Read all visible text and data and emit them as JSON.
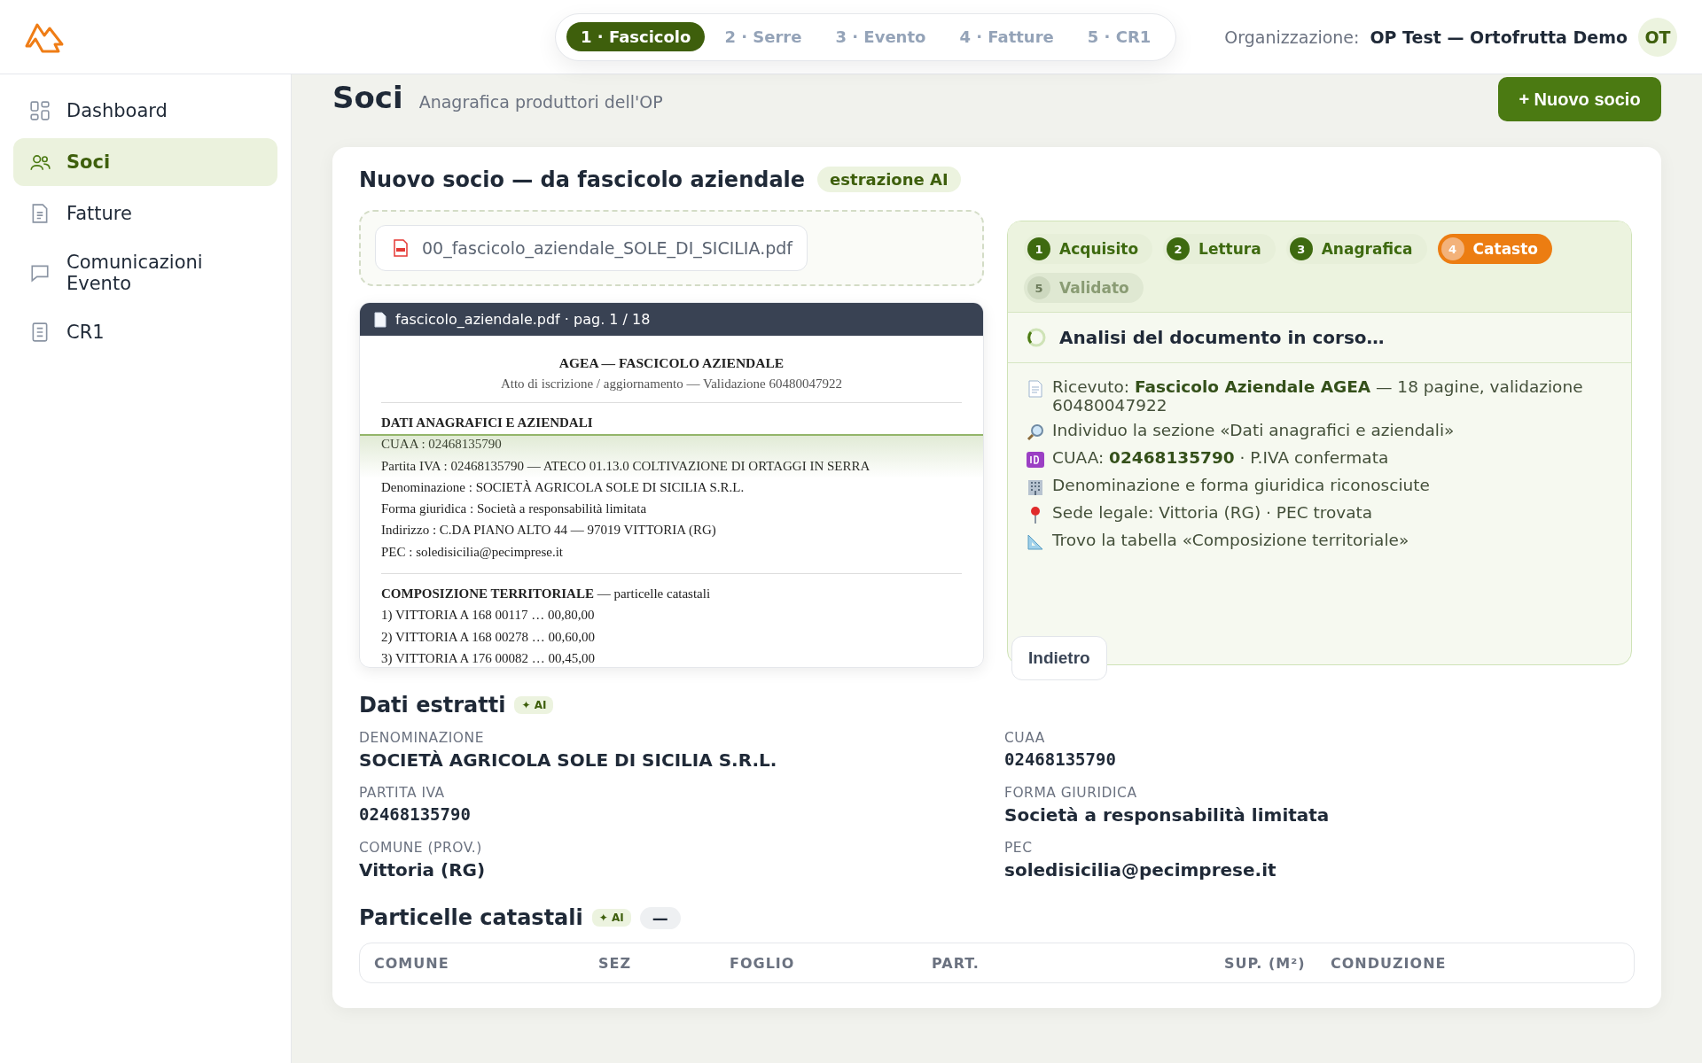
{
  "header": {
    "steps": [
      {
        "label": "1 · Fascicolo",
        "selected": true
      },
      {
        "label": "2 · Serre",
        "selected": false
      },
      {
        "label": "3 · Evento",
        "selected": false
      },
      {
        "label": "4 · Fatture",
        "selected": false
      },
      {
        "label": "5 · CR1",
        "selected": false
      }
    ],
    "org_label": "Organizzazione:",
    "org_name": "OP Test — Ortofrutta Demo",
    "avatar": "OT"
  },
  "sidebar": {
    "items": [
      {
        "label": "Dashboard",
        "selected": false
      },
      {
        "label": "Soci",
        "selected": true
      },
      {
        "label": "Fatture",
        "selected": false
      },
      {
        "label": "Comunicazioni Evento",
        "selected": false
      },
      {
        "label": "CR1",
        "selected": false
      }
    ]
  },
  "page": {
    "title": "Soci",
    "subtitle": "Anagrafica produttori dell'OP",
    "new_button": "+ Nuovo socio"
  },
  "card": {
    "title": "Nuovo socio — da fascicolo aziendale",
    "badge": "estrazione AI",
    "file": "00_fascicolo_aziendale_SOLE_DI_SICILIA.pdf",
    "preview": {
      "header": "fascicolo_aziendale.pdf · pag. 1 / 18",
      "doc_title": "AGEA — FASCICOLO AZIENDALE",
      "doc_subtitle": "Atto di iscrizione / aggiornamento — Validazione 60480047922",
      "sections": [
        {
          "lines": [
            "**DATI ANAGRAFICI E AZIENDALI**",
            "CUAA : 02468135790",
            "Partita IVA : 02468135790 — ATECO 01.13.0 COLTIVAZIONE DI ORTAGGI IN SERRA",
            "Denominazione : SOCIETÀ AGRICOLA SOLE DI SICILIA S.R.L.",
            "Forma giuridica : Società a responsabilità limitata",
            "Indirizzo : C.DA PIANO ALTO 44 — 97019 VITTORIA (RG)",
            "PEC : soledisicilia@pecimprese.it"
          ]
        },
        {
          "lines": [
            "**COMPOSIZIONE TERRITORIALE** — particelle catastali",
            "1) VITTORIA A 168 00117 … 00,80,00",
            "2) VITTORIA A 168 00278 … 00,60,00",
            "3) VITTORIA A 176 00082 … 00,45,00"
          ]
        }
      ]
    },
    "progress": {
      "steps": [
        {
          "number": "1",
          "label": "Acquisito",
          "completed": true,
          "active": false
        },
        {
          "number": "2",
          "label": "Lettura",
          "completed": true,
          "active": false
        },
        {
          "number": "3",
          "label": "Anagrafica",
          "completed": true,
          "active": false
        },
        {
          "number": "4",
          "label": "Catasto",
          "completed": false,
          "active": true
        },
        {
          "number": "5",
          "label": "Validato",
          "completed": false,
          "active": false
        }
      ],
      "status": "Analisi del documento in corso…",
      "log": [
        "Ricevuto: **Fascicolo Aziendale AGEA** — 18 pagine, validazione 60480047922",
        "Individuo la sezione «Dati anagrafici e aziendali»",
        "CUAA: **02468135790** · P.IVA confermata",
        "Denominazione e forma giuridica riconosciute",
        "Sede legale: Vittoria (RG) · PEC trovata",
        "Trovo la tabella «Composizione territoriale»"
      ],
      "back_button": "Indietro"
    },
    "extracted": {
      "title": "Dati estratti",
      "badge": "✦ AI",
      "fields": [
        {
          "label": "DENOMINAZIONE",
          "value": "SOCIETÀ AGRICOLA SOLE DI SICILIA S.R.L.",
          "kind": "text"
        },
        {
          "label": "CUAA",
          "value": "02468135790",
          "kind": "code"
        },
        {
          "label": "PARTITA IVA",
          "value": "02468135790",
          "kind": "code"
        },
        {
          "label": "FORMA GIURIDICA",
          "value": "Società a responsabilità limitata",
          "kind": "text"
        },
        {
          "label": "COMUNE (PROV.)",
          "value": "Vittoria (RG)",
          "kind": "text"
        },
        {
          "label": "PEC",
          "value": "soledisicilia@pecimprese.it",
          "kind": "text"
        }
      ]
    },
    "parcels": {
      "title": "Particelle catastali",
      "badge": "✦ AI",
      "count": "—",
      "columns": [
        "COMUNE",
        "SEZ",
        "FOGLIO",
        "PART.",
        "SUP. (M²)",
        "CONDUZIONE"
      ]
    }
  }
}
